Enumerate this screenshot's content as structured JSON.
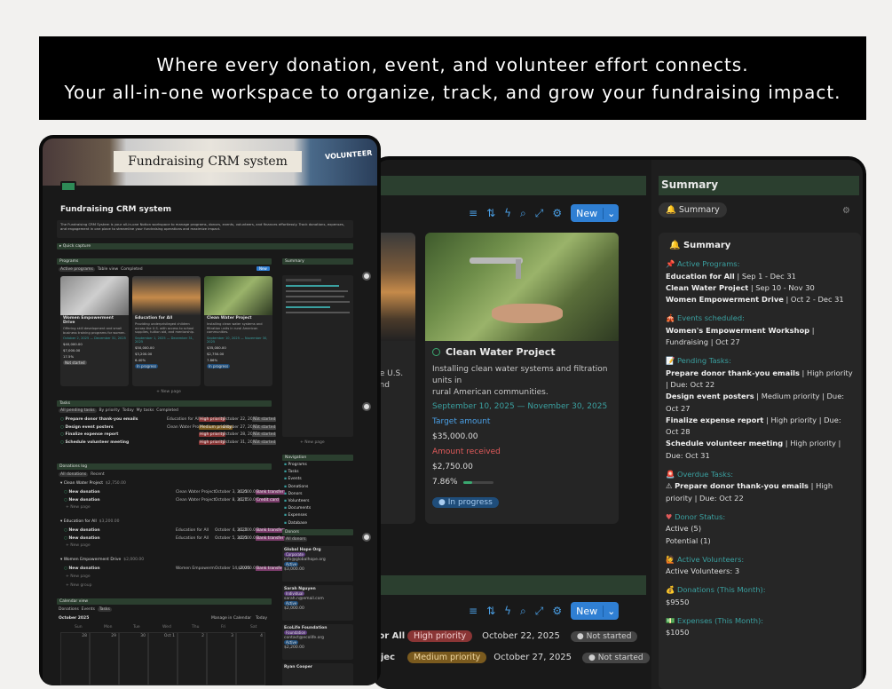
{
  "banner": {
    "line1": "Where every donation, event, and volunteer effort connects.",
    "line2": "Your all-in-one workspace to organize, track, and grow your fundraising impact."
  },
  "right": {
    "new_label": "New",
    "card2": {
      "title": "Clean Water Project",
      "desc1": "Installing clean water systems and filtration units in",
      "desc2": "rural American communities.",
      "date": "September 10, 2025 — November 30, 2025",
      "target_label": "Target amount",
      "target_value": "$35,000.00",
      "received_label": "Amount received",
      "received_value": "$2,750.00",
      "percent": "7.86%",
      "status": "In progress",
      "progress": 0.0786
    },
    "card1_partial": {
      "l1": "he U.S.",
      "l2": "and"
    },
    "tasks": [
      {
        "name": "for All",
        "priority": "High priority",
        "date": "October 22, 2025",
        "status": "Not started"
      },
      {
        "name": "ojec",
        "priority": "Medium priority",
        "date": "October 27, 2025",
        "status": "Not started"
      }
    ],
    "summary": {
      "header": "Summary",
      "tab": "Summary",
      "title": "Summary",
      "active_programs_h": "Active Programs:",
      "p1a": "Education for All",
      "p1b": " | Sep 1 - Dec 31",
      "p2a": "Clean Water Project",
      "p2b": " | Sep 10 - Nov 30",
      "p3a": "Women Empowerment Drive",
      "p3b": " | Oct 2 - Dec 31",
      "events_h": "Events scheduled:",
      "e1a": "Women's Empowerment Workshop",
      "e1b": " | Fundraising | Oct 27",
      "pending_h": "Pending Tasks:",
      "t1a": "Prepare donor thank-you emails",
      "t1b": " | High priority | Due: Oct 22",
      "t2a": "Design event posters",
      "t2b": " | Medium priority | Due: Oct 27",
      "t3a": "Finalize expense report",
      "t3b": " | High priority | Due: Oct 28",
      "t4a": "Schedule volunteer meeting",
      "t4b": " | High priority | Due: Oct 31",
      "overdue_h": "Overdue Tasks:",
      "o1a": "Prepare donor thank-you emails",
      "o1b": " | High priority | Due: Oct 22",
      "donor_h": "Donor Status:",
      "d1": "Active (5)",
      "d2": "Potential (1)",
      "vol_h": "Active Volunteers:",
      "v1": "Active Volunteers: 3",
      "don_h": "Donations (This Month):",
      "don_v": "$9550",
      "exp_h": "Expenses (This Month):",
      "exp_v": "$1050"
    }
  },
  "left": {
    "hero_title": "Fundraising CRM system",
    "hero_sign": "VOLUNTEER",
    "page_title": "Fundraising CRM system",
    "intro": "The Fundraising CRM System is your all-in-one Notion workspace to manage programs, donors, events, volunteers, and finances effortlessly. Track donations, expenses, and engagement in one place to streamline your fundraising operations and maximize impact.",
    "quick": "Quick capture",
    "programs": "Programs",
    "prog_tabs": [
      "Active programs",
      "Table view",
      "Completed"
    ],
    "new": "New",
    "cards": [
      {
        "t": "Women Empowerment Drive",
        "d": "Offering skill development and small business training programs for women.",
        "date": "October 2, 2025 — December 31, 2025",
        "v1": "$40,000.00",
        "v2": "$7,000.00",
        "pct": "17.5%",
        "s": "Not started"
      },
      {
        "t": "Education for All",
        "d": "Providing underprivileged children across the U.S. with access to school supplies, tuition aid, and mentorship.",
        "date": "September 1, 2025 — December 31, 2025",
        "v1": "$50,000.00",
        "v2": "$3,200.00",
        "pct": "6.40%",
        "s": "In progress"
      },
      {
        "t": "Clean Water Project",
        "d": "Installing clean water systems and filtration units in rural American communities.",
        "date": "September 10, 2025 — November 30, 2025",
        "v1": "$35,000.00",
        "v2": "$2,750.00",
        "pct": "7.86%",
        "s": "In progress"
      }
    ],
    "newpage": "+ New page",
    "tasks_h": "Tasks",
    "task_tabs": [
      "All pending tasks",
      "By priority",
      "Today",
      "My tasks",
      "Completed"
    ],
    "tasks": [
      {
        "n": "Prepare donor thank-you emails",
        "p": "Education for All",
        "pr": "High priority",
        "d": "October 22, 2025",
        "s": "Not started"
      },
      {
        "n": "Design event posters",
        "p": "Clean Water Proje",
        "pr": "Medium priority",
        "d": "October 27, 2025",
        "s": "Not started"
      },
      {
        "n": "Finalize expense report",
        "p": "",
        "pr": "High priority",
        "d": "October 28, 2025",
        "s": "Not started"
      },
      {
        "n": "Schedule volunteer meeting",
        "p": "",
        "pr": "High priority",
        "d": "October 31, 2025",
        "s": "Not started"
      }
    ],
    "donations_h": "Donations log",
    "don_tabs": [
      "All donations",
      "Recent"
    ],
    "groups": [
      {
        "g": "Clean Water Project",
        "amt": "$2,750.00",
        "rows": [
          {
            "n": "New donation",
            "p": "Clean Water Project",
            "d": "October 3, 2025",
            "a": "$1,000.00",
            "m": "Bank transfer"
          },
          {
            "n": "New donation",
            "p": "Clean Water Project",
            "d": "October 8, 2025",
            "a": "$1,750.00",
            "m": "Credit card"
          }
        ]
      },
      {
        "g": "Education for All",
        "amt": "$3,200.00",
        "rows": [
          {
            "n": "New donation",
            "p": "Education for All",
            "d": "October 4, 2025",
            "a": "$1,200.00",
            "m": "Bank transfer"
          },
          {
            "n": "New donation",
            "p": "Education for All",
            "d": "October 5, 2025",
            "a": "$2,000.00",
            "m": "Bank transfer"
          }
        ]
      },
      {
        "g": "Women Empowerment Drive",
        "amt": "$2,000.00",
        "rows": [
          {
            "n": "New donation",
            "p": "Women Empowerm",
            "d": "October 14, 2025",
            "a": "$2,000.00",
            "m": "Bank transfer"
          }
        ]
      }
    ],
    "newgroup": "+ New group",
    "calendar_h": "Calendar view",
    "cal_tabs": [
      "Donations",
      "Events",
      "Tasks"
    ],
    "month": "October 2025",
    "cal_btn": "Manage in Calendar",
    "today": "Today",
    "days": [
      "Sun",
      "Mon",
      "Tue",
      "Wed",
      "Thu",
      "Fri",
      "Sat"
    ],
    "dates": [
      "28",
      "29",
      "30",
      "Oct 1",
      "2",
      "3",
      "4"
    ],
    "side_summary": "Summary",
    "nav_h": "Navigation",
    "nav": [
      "Programs",
      "Tasks",
      "Events",
      "Donations",
      "Donors",
      "Volunteers",
      "Documents",
      "Expenses",
      "Database"
    ],
    "donors_h": "Donors",
    "donors_tab": "All donors",
    "donors": [
      {
        "n": "Global Hope Org",
        "t": "Corporate",
        "e": "info@globalhope.org",
        "s": "Active",
        "a": "$3,000.00"
      },
      {
        "n": "Sarah Nguyen",
        "t": "Individual",
        "e": "sarah.n@email.com",
        "s": "Active",
        "a": "$2,000.00"
      },
      {
        "n": "EcoLife Foundation",
        "t": "Foundation",
        "e": "contact@ecolife.org",
        "s": "Active",
        "a": "$2,200.00"
      },
      {
        "n": "Ryan Cooper",
        "t": "",
        "e": "",
        "s": "",
        "a": ""
      }
    ]
  }
}
